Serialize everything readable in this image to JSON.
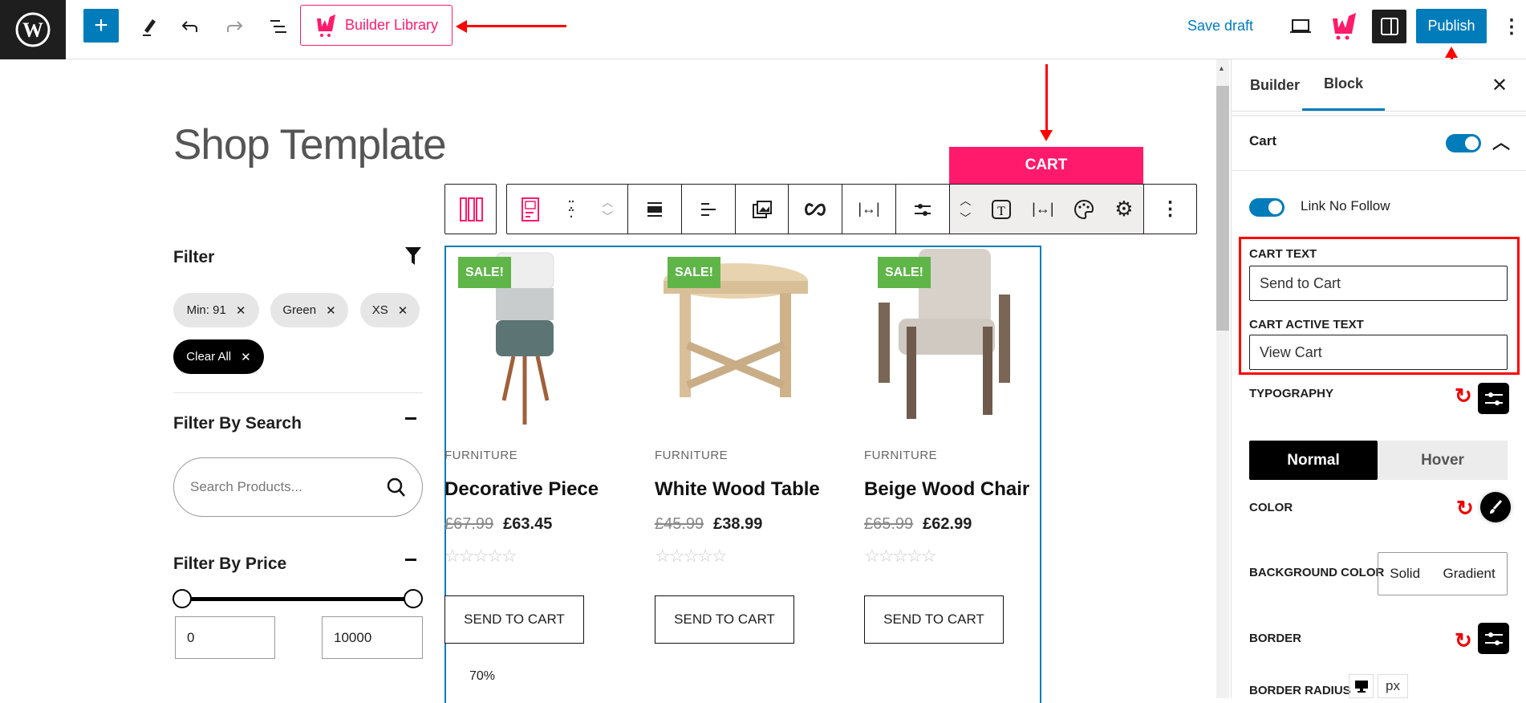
{
  "topbar": {
    "builder_library_label": "Builder Library",
    "save_draft_label": "Save draft",
    "publish_label": "Publish"
  },
  "canvas": {
    "page_title": "Shop Template",
    "block_label": "CART",
    "zoom_text": "70%"
  },
  "filter": {
    "title": "Filter",
    "chips": [
      {
        "label": "Min: 91"
      },
      {
        "label": "Green"
      },
      {
        "label": "XS"
      }
    ],
    "clear_all_label": "Clear All",
    "search_title": "Filter By Search",
    "search_placeholder": "Search Products...",
    "price_title": "Filter By Price",
    "price_min": "0",
    "price_max": "10000"
  },
  "products": [
    {
      "badge": "SALE!",
      "category": "FURNITURE",
      "name": "Decorative Piece",
      "old_price": "£67.99",
      "price": "£63.45",
      "button": "SEND TO CART",
      "rating": 0
    },
    {
      "badge": "SALE!",
      "category": "FURNITURE",
      "name": "White Wood Table",
      "old_price": "£45.99",
      "price": "£38.99",
      "button": "SEND TO CART",
      "rating": 0
    },
    {
      "badge": "SALE!",
      "category": "FURNITURE",
      "name": "Beige Wood Chair",
      "old_price": "£65.99",
      "price": "£62.99",
      "button": "SEND TO CART",
      "rating": 0
    }
  ],
  "panel": {
    "tabs": [
      {
        "label": "Builder"
      },
      {
        "label": "Block",
        "active": true
      }
    ],
    "section_title": "Cart",
    "section_enabled": true,
    "link_no_follow_label": "Link No Follow",
    "link_no_follow_enabled": true,
    "cart_text_label": "CART TEXT",
    "cart_text_value": "Send to Cart",
    "cart_active_text_label": "CART ACTIVE TEXT",
    "cart_active_text_value": "View Cart",
    "typography_label": "TYPOGRAPHY",
    "state_tabs": [
      {
        "label": "Normal",
        "active": true
      },
      {
        "label": "Hover"
      }
    ],
    "color_label": "COLOR",
    "bg_color_label": "BACKGROUND COLOR",
    "bg_options": [
      {
        "label": "Solid"
      },
      {
        "label": "Gradient"
      }
    ],
    "border_label": "BORDER",
    "border_radius_label": "BORDER RADIUS",
    "unit": "px"
  },
  "colors": {
    "accent": "#007cba",
    "brand": "#ff1a6c",
    "sale": "#5fb548",
    "highlight": "#ff0000"
  }
}
